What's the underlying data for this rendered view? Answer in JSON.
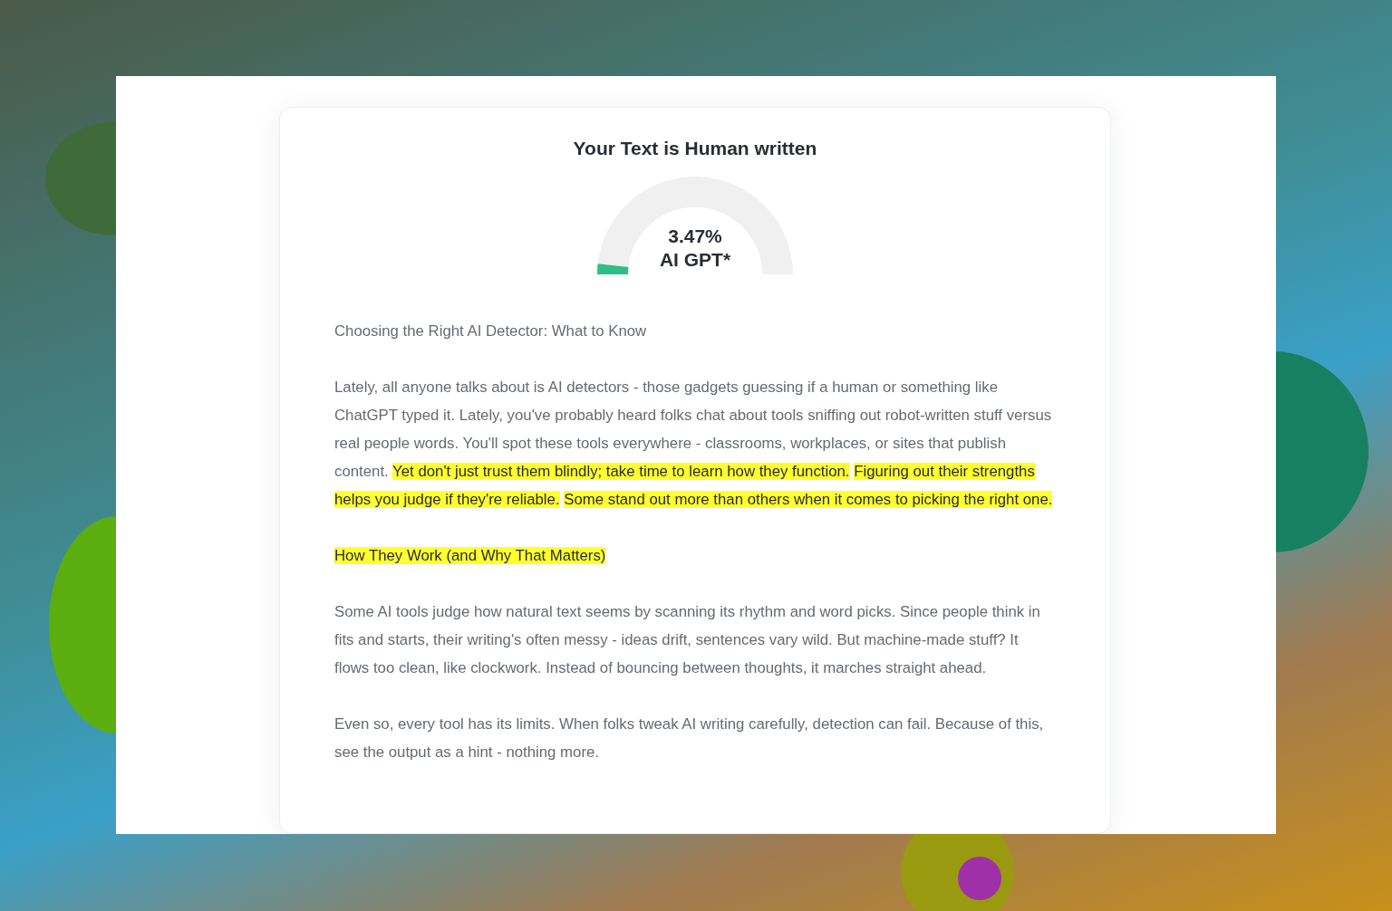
{
  "result": {
    "title": "Your Text is Human written",
    "gauge": {
      "level": 0.0347,
      "percent": "3.47%",
      "label": "AI GPT*"
    }
  },
  "paragraphs": [
    {
      "segments": [
        {
          "text": "Choosing the Right AI Detector: What to Know",
          "highlighted": false
        }
      ]
    },
    {
      "segments": [
        {
          "text": "Lately, all anyone talks about is AI detectors - those gadgets guessing if a human or something like ChatGPT typed it. Lately, you've probably heard folks chat about tools sniffing out robot-written stuff versus real people words. You'll spot these tools everywhere - classrooms, workplaces, or sites that publish content.",
          "highlighted": false
        },
        {
          "text": "Yet don't just trust them blindly; take time to learn how they function.",
          "highlighted": true
        },
        {
          "text": "Figuring out their strengths helps you judge if they're reliable.",
          "highlighted": true
        },
        {
          "text": "Some stand out more than others when it comes to picking the right one.",
          "highlighted": true
        }
      ]
    },
    {
      "segments": [
        {
          "text": "How They Work (and Why That Matters)",
          "highlighted": true
        }
      ]
    },
    {
      "segments": [
        {
          "text": "Some AI tools judge how natural text seems by scanning its rhythm and word picks. Since people think in fits and starts, their writing's often messy - ideas drift, sentences vary wild. But machine-made stuff? It flows too clean, like clockwork. Instead of bouncing between thoughts, it marches straight ahead.",
          "highlighted": false
        }
      ]
    },
    {
      "segments": [
        {
          "text": "Even so, every tool has its limits. When folks tweak AI writing carefully, detection can fail. Because of this, see the output as a hint - nothing more.",
          "highlighted": false
        }
      ]
    }
  ]
}
